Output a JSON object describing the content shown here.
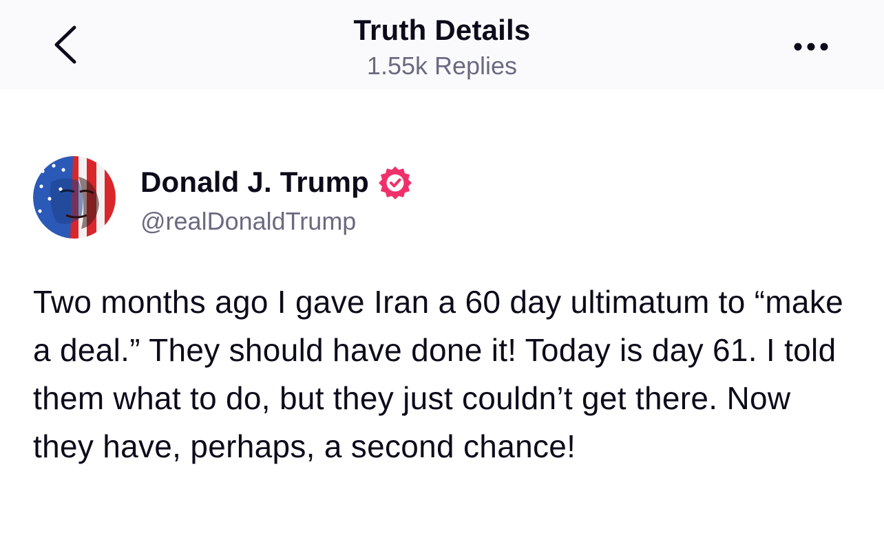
{
  "header": {
    "title": "Truth Details",
    "subtitle": "1.55k Replies",
    "back_icon": "chevron-left-icon",
    "more_icon": "more-horizontal-icon"
  },
  "author": {
    "name": "Donald J. Trump",
    "handle": "@realDonaldTrump",
    "verified_icon": "verified-badge-icon",
    "verified_color": "#f0306a"
  },
  "post": {
    "text": "Two months ago I gave Iran a 60 day ultimatum to “make a deal.” They should have done it! Today is day 61. I told them what to do, but they just couldn’t get there. Now they have, perhaps, a second chance!"
  },
  "colors": {
    "header_bg": "#fafafc",
    "text_primary": "#0b0b1a",
    "text_secondary": "#6a6a80"
  }
}
